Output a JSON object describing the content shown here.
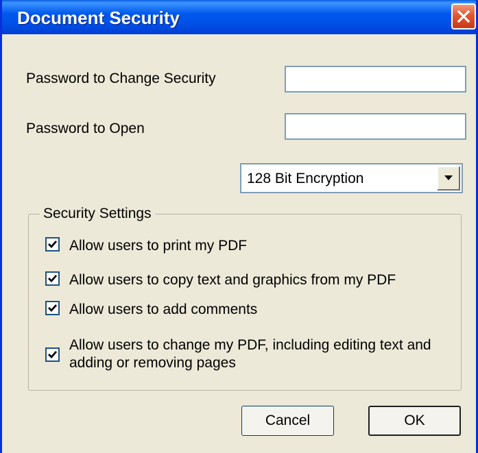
{
  "window": {
    "title": "Document Security"
  },
  "fields": {
    "change_security_label": "Password to Change Security",
    "change_security_value": "",
    "open_label": "Password to Open",
    "open_value": ""
  },
  "encryption": {
    "selected": "128 Bit Encryption"
  },
  "security_settings": {
    "title": "Security Settings",
    "options": [
      {
        "label": "Allow users to print my PDF",
        "checked": true
      },
      {
        "label": "Allow users to copy text and graphics from my PDF",
        "checked": true
      },
      {
        "label": "Allow users to add comments",
        "checked": true
      },
      {
        "label": "Allow users to change my PDF, including editing text and adding or removing pages",
        "checked": true
      }
    ]
  },
  "buttons": {
    "cancel": "Cancel",
    "ok": "OK"
  },
  "colors": {
    "titlebar": "#0058ee",
    "dialog_bg": "#ece9d8",
    "close_button": "#e2572f"
  },
  "icons": {
    "close": "close-icon",
    "dropdown": "chevron-down-icon",
    "check": "checkmark-icon"
  }
}
